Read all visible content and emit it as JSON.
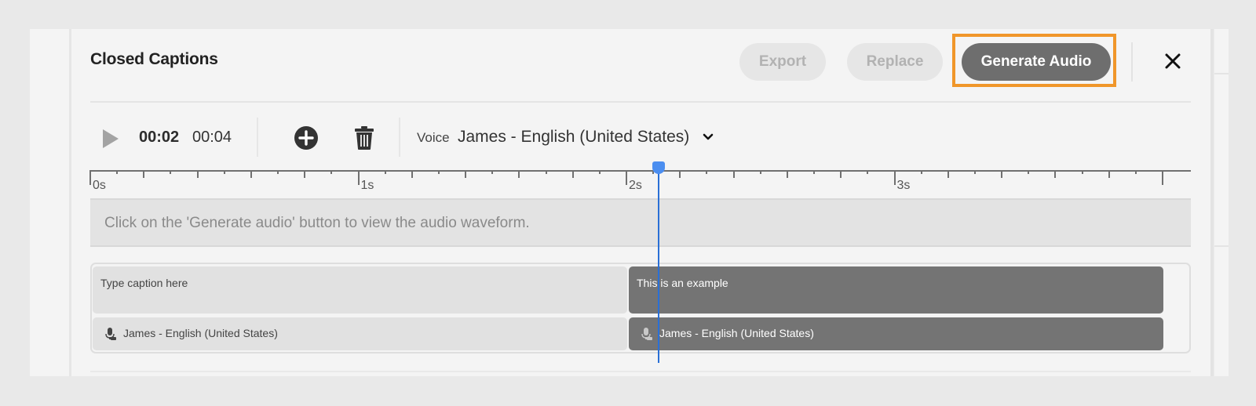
{
  "panel": {
    "title": "Closed Captions"
  },
  "header": {
    "export_label": "Export",
    "replace_label": "Replace",
    "generate_audio_label": "Generate Audio",
    "export_enabled": false,
    "replace_enabled": false,
    "highlight_color": "#f0962a",
    "close_icon": "close-icon"
  },
  "toolbar": {
    "play_icon": "play-icon",
    "current_time": "00:02",
    "total_time": "00:04",
    "add_icon": "add-circle-icon",
    "delete_icon": "trash-icon",
    "voice_label": "Voice",
    "voice_value": "James - English (United States)"
  },
  "timeline": {
    "labels": [
      "0s",
      "1s",
      "2s",
      "3s"
    ],
    "visible_range_seconds": [
      0,
      4.1
    ],
    "tick_interval_seconds": 0.1,
    "playhead_seconds": 2.12,
    "playhead_color": "#2a6fd6"
  },
  "waveform": {
    "message": "Click on the 'Generate audio' button to view the audio waveform."
  },
  "captions": [
    {
      "text": "Type caption here",
      "voice": "James - English (United States)",
      "start": 0.0,
      "end": 2.0,
      "selected": false
    },
    {
      "text": "This is an example",
      "voice": "James - English (United States)",
      "start": 2.0,
      "end": 4.0,
      "selected": true
    }
  ]
}
